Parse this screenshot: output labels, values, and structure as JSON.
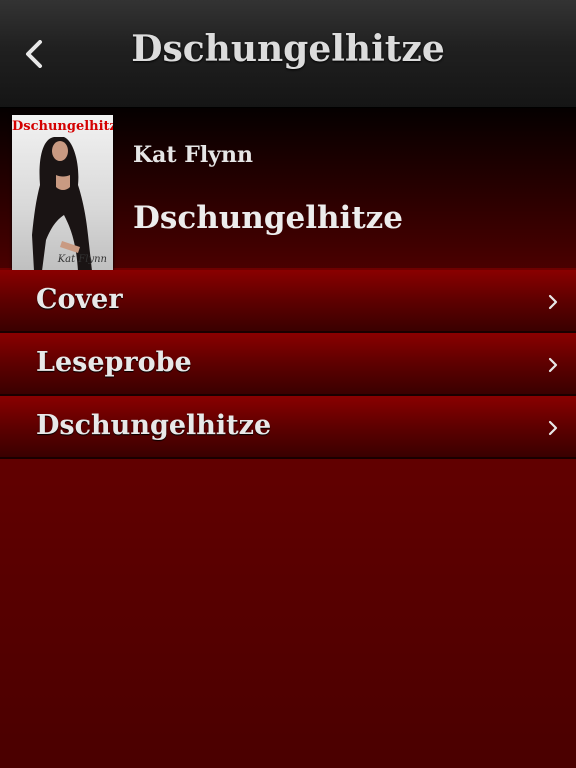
{
  "navbar": {
    "title": "Dschungelhitze",
    "back_icon": "chevron-left-icon"
  },
  "book": {
    "cover_title": "Dschungelhitze",
    "cover_author": "Kat Flynn",
    "author": "Kat Flynn",
    "title": "Dschungelhitze"
  },
  "menu": {
    "items": [
      {
        "label": "Cover",
        "icon": "chevron-right-icon"
      },
      {
        "label": "Leseprobe",
        "icon": "chevron-right-icon"
      },
      {
        "label": "Dschungelhitze",
        "icon": "chevron-right-icon"
      }
    ]
  },
  "colors": {
    "background": "#6a0000",
    "navbar": "#202020",
    "cover_title": "#d40000",
    "text": "#e8e8e8"
  }
}
